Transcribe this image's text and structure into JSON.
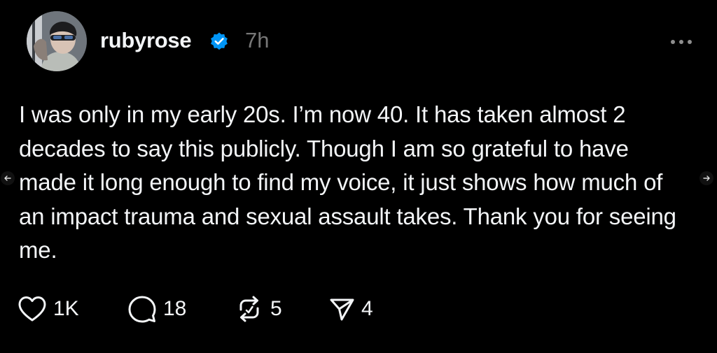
{
  "post": {
    "username": "rubyrose",
    "verified": true,
    "time": "7h",
    "text": "I was only in my early 20s. I’m now 40. It has taken almost 2 decades to say this publicly. Though I am so grateful to have made it long enough to find my voice, it just shows how much of an impact trauma and sexual assault takes. Thank you for seeing me.",
    "stats": {
      "likes": "1K",
      "comments": "18",
      "reposts": "5",
      "shares": "4"
    }
  },
  "colors": {
    "background": "#000000",
    "text": "#f3f5f7",
    "muted": "#777777",
    "verified_badge": "#0095f6"
  },
  "icons": {
    "more": "more-horizontal-icon",
    "like": "heart-icon",
    "comment": "comment-bubble-icon",
    "repost": "repost-icon",
    "share": "send-icon",
    "nav_left": "arrow-left-icon",
    "nav_right": "arrow-right-icon"
  }
}
